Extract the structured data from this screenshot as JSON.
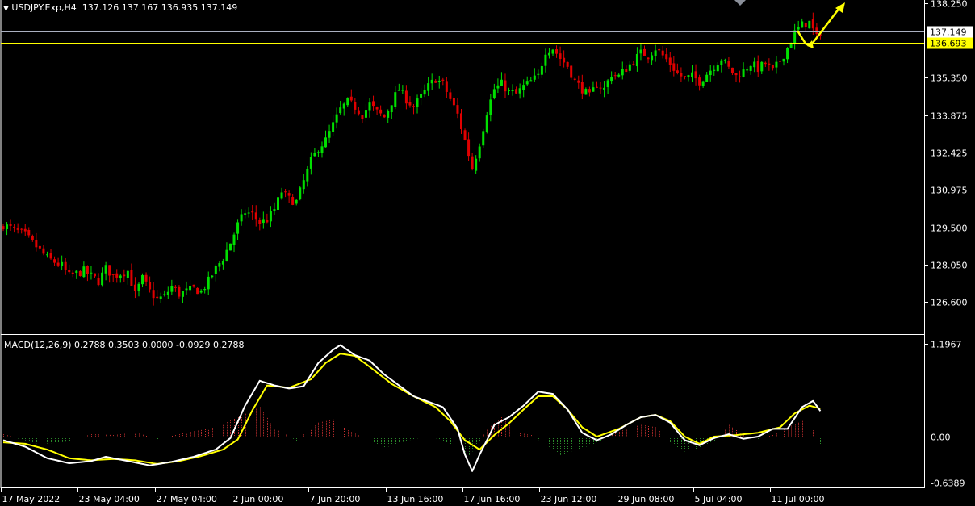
{
  "header": {
    "symbol": "USDJPY.Exp,H4",
    "ohlc": "137.126 137.167 136.935 137.149"
  },
  "macd_header": {
    "label": "MACD(12,26,9)",
    "values": "0.2788 0.3503 0.0000 -0.0929 0.2788"
  },
  "colors": {
    "background": "#000000",
    "bull": "#00e000",
    "bear": "#e00000",
    "grid_line": "#ffffff",
    "macd_line": "#ffffff",
    "signal_line": "#ffff00",
    "hist_pos": "#c83030",
    "hist_neg": "#2a8a2a",
    "arrow": "#ffff00",
    "price_tag_current": "#ffffff",
    "price_tag_level": "#ffff00"
  },
  "chart_data": [
    {
      "type": "candlestick",
      "title": "USDJPY.Exp,H4",
      "ylim": [
        125.9,
        138.25
      ],
      "y_ticks": [
        "138.250",
        "135.350",
        "133.875",
        "132.425",
        "130.975",
        "129.500",
        "128.050",
        "126.600"
      ],
      "x_ticks": [
        "17 May 2022",
        "23 May 04:00",
        "27 May 04:00",
        "2 Jun 00:00",
        "7 Jun 20:00",
        "13 Jun 16:00",
        "17 Jun 16:00",
        "23 Jun 12:00",
        "29 Jun 08:00",
        "5 Jul 04:00",
        "11 Jul 00:00"
      ],
      "horizontal_levels": [
        {
          "label": "137.149",
          "value": 137.149,
          "style": "current"
        },
        {
          "label": "136.693",
          "value": 136.693,
          "style": "level"
        }
      ],
      "close_path": [
        [
          0,
          129.6
        ],
        [
          6,
          129.2
        ],
        [
          10,
          128.6
        ],
        [
          12,
          128.3
        ],
        [
          16,
          128.0
        ],
        [
          18,
          127.6
        ],
        [
          22,
          127.8
        ],
        [
          26,
          127.4
        ],
        [
          28,
          127.9
        ],
        [
          30,
          127.6
        ],
        [
          34,
          127.8
        ],
        [
          36,
          126.9
        ],
        [
          38,
          127.5
        ],
        [
          40,
          127.0
        ],
        [
          42,
          126.7
        ],
        [
          44,
          126.8
        ],
        [
          46,
          127.2
        ],
        [
          48,
          126.9
        ],
        [
          52,
          127.1
        ],
        [
          54,
          127.0
        ],
        [
          56,
          127.4
        ],
        [
          58,
          127.9
        ],
        [
          60,
          128.3
        ],
        [
          62,
          128.9
        ],
        [
          64,
          129.6
        ],
        [
          66,
          130.1
        ],
        [
          68,
          130.0
        ],
        [
          70,
          129.7
        ],
        [
          72,
          129.8
        ],
        [
          74,
          130.2
        ],
        [
          76,
          130.9
        ],
        [
          78,
          130.6
        ],
        [
          80,
          130.5
        ],
        [
          82,
          131.3
        ],
        [
          84,
          132.1
        ],
        [
          86,
          132.6
        ],
        [
          88,
          132.9
        ],
        [
          90,
          133.5
        ],
        [
          92,
          134.1
        ],
        [
          94,
          134.4
        ],
        [
          96,
          134.2
        ],
        [
          98,
          133.9
        ],
        [
          100,
          134.3
        ],
        [
          102,
          134.0
        ],
        [
          104,
          133.8
        ],
        [
          106,
          134.4
        ],
        [
          108,
          134.9
        ],
        [
          110,
          134.5
        ],
        [
          112,
          134.2
        ],
        [
          114,
          134.6
        ],
        [
          116,
          135.0
        ],
        [
          118,
          135.3
        ],
        [
          120,
          135.1
        ],
        [
          122,
          134.5
        ],
        [
          124,
          133.9
        ],
        [
          126,
          132.9
        ],
        [
          128,
          131.8
        ],
        [
          130,
          132.8
        ],
        [
          132,
          134.0
        ],
        [
          134,
          134.9
        ],
        [
          136,
          135.1
        ],
        [
          138,
          134.8
        ],
        [
          140,
          134.7
        ],
        [
          142,
          135.0
        ],
        [
          144,
          135.2
        ],
        [
          146,
          135.4
        ],
        [
          148,
          136.4
        ],
        [
          150,
          136.5
        ],
        [
          152,
          136.1
        ],
        [
          154,
          135.8
        ],
        [
          156,
          135.2
        ],
        [
          158,
          134.9
        ],
        [
          160,
          134.6
        ],
        [
          162,
          135.1
        ],
        [
          164,
          134.9
        ],
        [
          166,
          135.5
        ],
        [
          168,
          135.4
        ],
        [
          170,
          135.7
        ],
        [
          172,
          136.0
        ],
        [
          174,
          136.3
        ],
        [
          176,
          136.2
        ],
        [
          178,
          136.5
        ],
        [
          180,
          136.2
        ],
        [
          182,
          135.9
        ],
        [
          184,
          135.5
        ],
        [
          186,
          135.3
        ],
        [
          188,
          135.4
        ],
        [
          190,
          135.2
        ],
        [
          192,
          135.5
        ],
        [
          194,
          135.8
        ],
        [
          196,
          136.1
        ],
        [
          198,
          135.7
        ],
        [
          200,
          135.4
        ],
        [
          202,
          135.6
        ],
        [
          204,
          135.9
        ],
        [
          206,
          135.7
        ],
        [
          208,
          135.9
        ],
        [
          210,
          135.6
        ],
        [
          212,
          136.0
        ],
        [
          214,
          136.5
        ],
        [
          216,
          137.1
        ],
        [
          218,
          137.4
        ],
        [
          220,
          137.5
        ],
        [
          222,
          136.9
        ],
        [
          223,
          137.15
        ]
      ]
    },
    {
      "type": "macd",
      "title": "MACD(12,26,9)",
      "ylim": [
        -0.6389,
        1.1967
      ],
      "y_ticks": [
        "1.1967",
        "0.00",
        "-0.6389"
      ],
      "macd_path": [
        [
          0,
          -0.05
        ],
        [
          6,
          -0.14
        ],
        [
          12,
          -0.3
        ],
        [
          18,
          -0.37
        ],
        [
          24,
          -0.34
        ],
        [
          28,
          -0.28
        ],
        [
          34,
          -0.34
        ],
        [
          40,
          -0.4
        ],
        [
          46,
          -0.35
        ],
        [
          52,
          -0.28
        ],
        [
          58,
          -0.18
        ],
        [
          62,
          -0.02
        ],
        [
          66,
          0.4
        ],
        [
          70,
          0.72
        ],
        [
          74,
          0.66
        ],
        [
          78,
          0.62
        ],
        [
          82,
          0.65
        ],
        [
          86,
          0.95
        ],
        [
          90,
          1.12
        ],
        [
          92,
          1.18
        ],
        [
          96,
          1.05
        ],
        [
          100,
          0.98
        ],
        [
          104,
          0.8
        ],
        [
          108,
          0.66
        ],
        [
          112,
          0.52
        ],
        [
          116,
          0.45
        ],
        [
          120,
          0.38
        ],
        [
          124,
          0.1
        ],
        [
          126,
          -0.25
        ],
        [
          128,
          -0.48
        ],
        [
          130,
          -0.25
        ],
        [
          134,
          0.15
        ],
        [
          138,
          0.25
        ],
        [
          142,
          0.4
        ],
        [
          146,
          0.58
        ],
        [
          150,
          0.55
        ],
        [
          154,
          0.35
        ],
        [
          158,
          0.05
        ],
        [
          162,
          -0.05
        ],
        [
          166,
          0.03
        ],
        [
          170,
          0.15
        ],
        [
          174,
          0.25
        ],
        [
          178,
          0.28
        ],
        [
          182,
          0.18
        ],
        [
          186,
          -0.05
        ],
        [
          190,
          -0.12
        ],
        [
          194,
          -0.02
        ],
        [
          198,
          0.03
        ],
        [
          202,
          -0.03
        ],
        [
          206,
          0.0
        ],
        [
          210,
          0.1
        ],
        [
          214,
          0.1
        ],
        [
          218,
          0.38
        ],
        [
          221,
          0.46
        ],
        [
          223,
          0.33
        ]
      ],
      "signal_path": [
        [
          0,
          -0.08
        ],
        [
          6,
          -0.1
        ],
        [
          12,
          -0.18
        ],
        [
          18,
          -0.3
        ],
        [
          24,
          -0.33
        ],
        [
          30,
          -0.31
        ],
        [
          36,
          -0.33
        ],
        [
          42,
          -0.38
        ],
        [
          48,
          -0.34
        ],
        [
          54,
          -0.27
        ],
        [
          60,
          -0.18
        ],
        [
          64,
          -0.04
        ],
        [
          68,
          0.34
        ],
        [
          72,
          0.66
        ],
        [
          78,
          0.63
        ],
        [
          84,
          0.74
        ],
        [
          88,
          0.95
        ],
        [
          92,
          1.07
        ],
        [
          96,
          1.04
        ],
        [
          100,
          0.9
        ],
        [
          106,
          0.68
        ],
        [
          112,
          0.52
        ],
        [
          118,
          0.38
        ],
        [
          122,
          0.2
        ],
        [
          126,
          -0.05
        ],
        [
          130,
          -0.18
        ],
        [
          134,
          0.02
        ],
        [
          138,
          0.17
        ],
        [
          142,
          0.35
        ],
        [
          146,
          0.52
        ],
        [
          150,
          0.52
        ],
        [
          154,
          0.35
        ],
        [
          158,
          0.12
        ],
        [
          162,
          0.0
        ],
        [
          168,
          0.1
        ],
        [
          174,
          0.25
        ],
        [
          178,
          0.28
        ],
        [
          182,
          0.2
        ],
        [
          186,
          0.0
        ],
        [
          190,
          -0.1
        ],
        [
          194,
          0.0
        ],
        [
          200,
          0.02
        ],
        [
          206,
          0.05
        ],
        [
          212,
          0.12
        ],
        [
          216,
          0.3
        ],
        [
          220,
          0.4
        ],
        [
          223,
          0.36
        ]
      ],
      "histogram_path": [
        [
          0,
          0.03
        ],
        [
          10,
          -0.1
        ],
        [
          18,
          -0.06
        ],
        [
          24,
          0.03
        ],
        [
          30,
          0.02
        ],
        [
          36,
          0.05
        ],
        [
          42,
          -0.03
        ],
        [
          50,
          0.05
        ],
        [
          58,
          0.12
        ],
        [
          64,
          0.25
        ],
        [
          70,
          0.38
        ],
        [
          74,
          0.1
        ],
        [
          80,
          -0.05
        ],
        [
          86,
          0.18
        ],
        [
          90,
          0.22
        ],
        [
          94,
          0.08
        ],
        [
          100,
          -0.05
        ],
        [
          104,
          -0.15
        ],
        [
          110,
          -0.05
        ],
        [
          116,
          0.01
        ],
        [
          120,
          -0.05
        ],
        [
          124,
          -0.15
        ],
        [
          126,
          -0.3
        ],
        [
          128,
          -0.2
        ],
        [
          132,
          0.1
        ],
        [
          136,
          0.25
        ],
        [
          140,
          0.05
        ],
        [
          144,
          0.02
        ],
        [
          148,
          -0.1
        ],
        [
          152,
          -0.25
        ],
        [
          156,
          -0.18
        ],
        [
          160,
          -0.12
        ],
        [
          166,
          0.02
        ],
        [
          170,
          0.1
        ],
        [
          174,
          0.15
        ],
        [
          178,
          0.12
        ],
        [
          182,
          -0.08
        ],
        [
          186,
          -0.2
        ],
        [
          190,
          -0.15
        ],
        [
          194,
          -0.05
        ],
        [
          198,
          0.15
        ],
        [
          204,
          -0.05
        ],
        [
          210,
          0.02
        ],
        [
          214,
          0.12
        ],
        [
          218,
          0.2
        ],
        [
          221,
          0.08
        ],
        [
          223,
          -0.1
        ]
      ]
    }
  ]
}
